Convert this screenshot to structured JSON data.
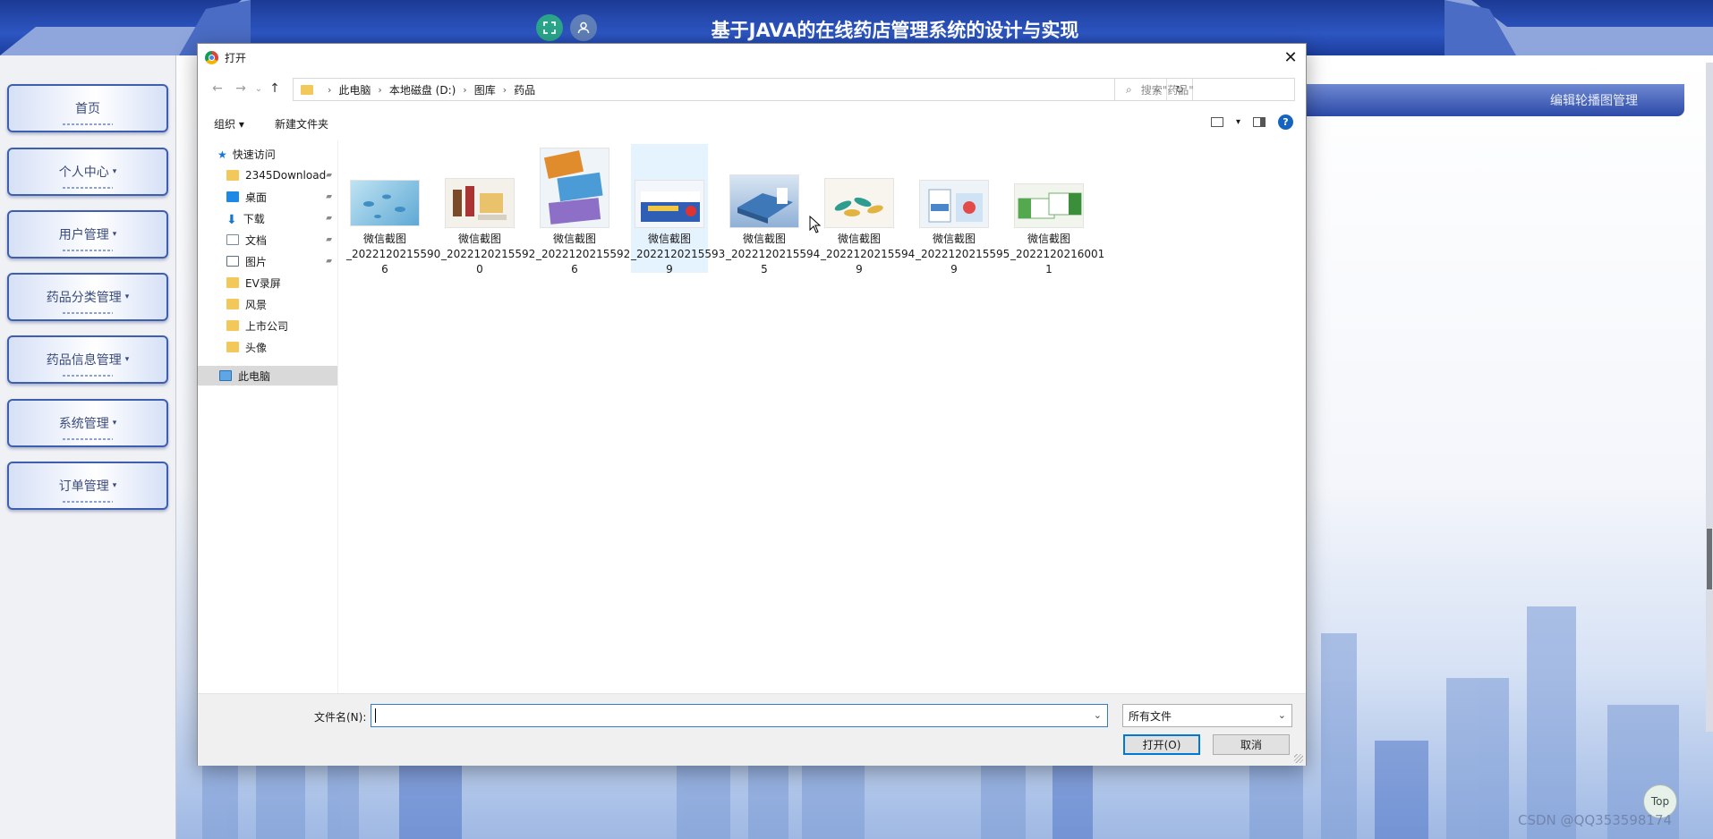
{
  "app": {
    "title": "基于JAVA的在线药店管理系统的设计与实现",
    "breadcrumb": "编辑轮播图管理",
    "top_button": "Top",
    "watermark": "CSDN @QQ353598174",
    "icons": [
      "expand-icon",
      "user-icon"
    ]
  },
  "sidebar": {
    "items": [
      {
        "label": "首页",
        "caret": ""
      },
      {
        "label": "个人中心",
        "caret": "▾"
      },
      {
        "label": "用户管理",
        "caret": "▾"
      },
      {
        "label": "药品分类管理",
        "caret": "▾"
      },
      {
        "label": "药品信息管理",
        "caret": "▾"
      },
      {
        "label": "系统管理",
        "caret": "▾"
      },
      {
        "label": "订单管理",
        "caret": "▾"
      }
    ]
  },
  "dialog": {
    "title": "打开",
    "close": "✕",
    "nav": {
      "back": "←",
      "forward": "→",
      "recent": "⌄",
      "up": "↑"
    },
    "address": {
      "crumbs": [
        "此电脑",
        "本地磁盘 (D:)",
        "图库",
        "药品"
      ],
      "separator": "›",
      "refresh": "↻",
      "dropdown": "⌄"
    },
    "search": {
      "placeholder": "搜索\"药品\"",
      "icon": "⌕"
    },
    "toolbar": {
      "organize": "组织 ▾",
      "new_folder": "新建文件夹",
      "help": "?",
      "view_dd": "▾"
    },
    "nav_pane": {
      "quick_access": "快速访问",
      "items": [
        {
          "label": "2345Download",
          "icon": "folder",
          "pinned": true
        },
        {
          "label": "桌面",
          "icon": "desktop",
          "pinned": true
        },
        {
          "label": "下载",
          "icon": "download",
          "pinned": true
        },
        {
          "label": "文档",
          "icon": "docs",
          "pinned": true
        },
        {
          "label": "图片",
          "icon": "pics",
          "pinned": true
        },
        {
          "label": "EV录屏",
          "icon": "folder",
          "pinned": false
        },
        {
          "label": "风景",
          "icon": "folder",
          "pinned": false
        },
        {
          "label": "上市公司",
          "icon": "folder",
          "pinned": false
        },
        {
          "label": "头像",
          "icon": "folder",
          "pinned": false
        }
      ],
      "this_pc": "此电脑",
      "pin_glyph": "📌"
    },
    "files": [
      {
        "line1": "微信截图",
        "line2": "_2022120215590",
        "line3": "6"
      },
      {
        "line1": "微信截图",
        "line2": "_2022120215592",
        "line3": "0"
      },
      {
        "line1": "微信截图",
        "line2": "_2022120215592",
        "line3": "6"
      },
      {
        "line1": "微信截图",
        "line2": "_2022120215593",
        "line3": "9",
        "selected": true
      },
      {
        "line1": "微信截图",
        "line2": "_2022120215594",
        "line3": "5"
      },
      {
        "line1": "微信截图",
        "line2": "_2022120215594",
        "line3": "9"
      },
      {
        "line1": "微信截图",
        "line2": "_2022120215595",
        "line3": "9"
      },
      {
        "line1": "微信截图",
        "line2": "_2022120216001",
        "line3": "1"
      }
    ],
    "footer": {
      "filename_label": "文件名(N):",
      "filename_value": "",
      "filetype": "所有文件",
      "open": "打开(O)",
      "cancel": "取消",
      "dropdown": "⌄"
    }
  }
}
